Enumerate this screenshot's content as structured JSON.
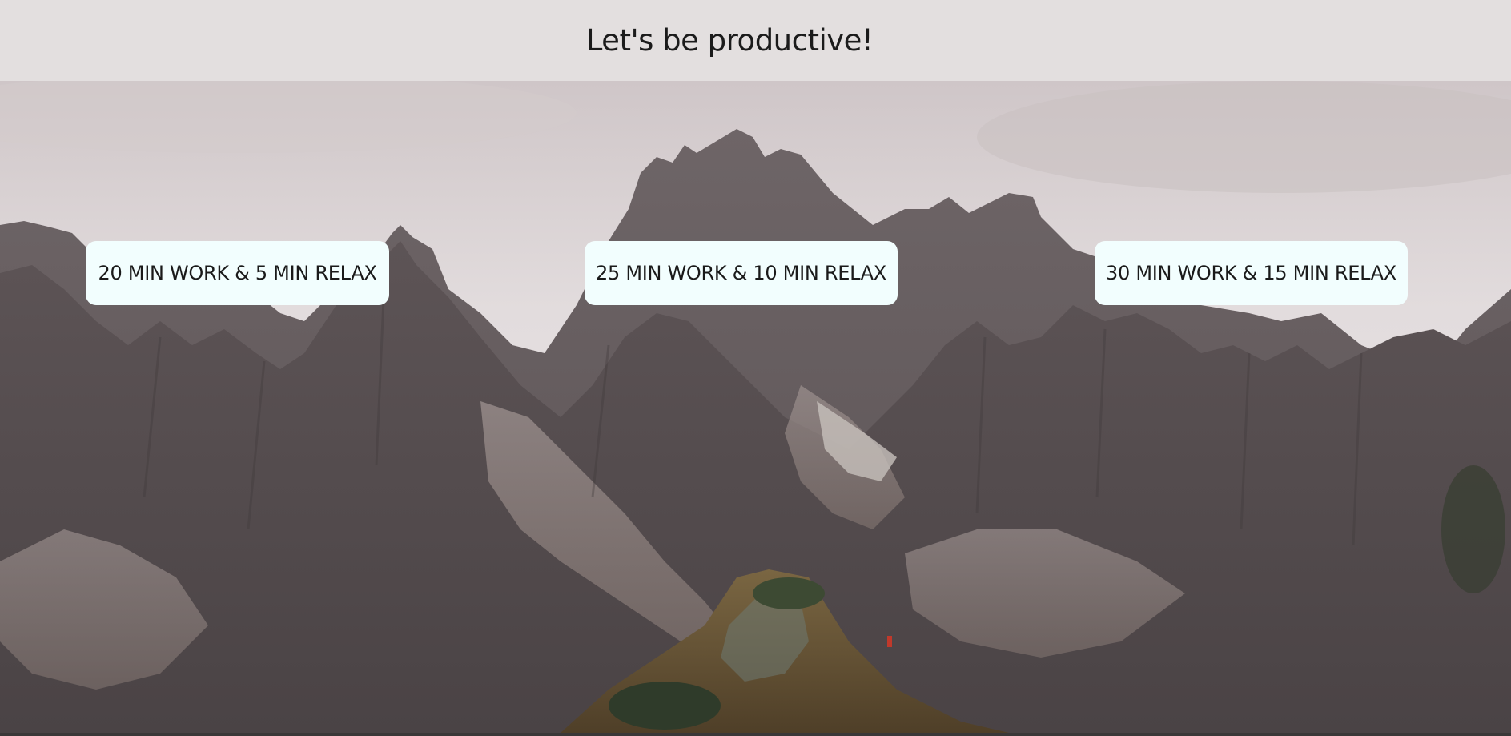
{
  "header": {
    "title": "Let's be productive!"
  },
  "presets": [
    {
      "label": "20 MIN WORK & 5 MIN RELAX"
    },
    {
      "label": "25 MIN WORK & 10 MIN RELAX"
    },
    {
      "label": "30 MIN WORK & 15 MIN RELAX"
    }
  ],
  "colors": {
    "header_bg": "#e3dfdf",
    "button_bg": "#f2fefe",
    "text": "#1a1a1a"
  }
}
